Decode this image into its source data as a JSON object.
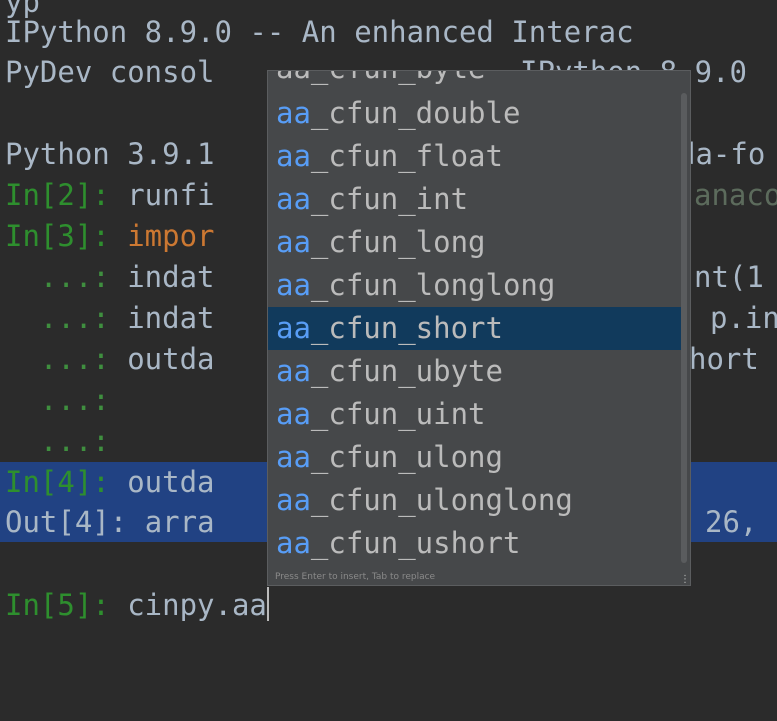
{
  "console": {
    "line0": "yp",
    "line1": "IPython 8.9.0 -- An enhanced Interac",
    "line2_prefix": "PyDev consol",
    "line2_suffix": "IPython 8.9.0",
    "line4_prefix": "Python 3.9.1",
    "line4_suffix": "da-fo",
    "in2_prompt": "In[2]: ",
    "in2_code": "runfi",
    "in2_tail": "anaco",
    "in3_prompt": "In[3]: ",
    "in3_code": "impor",
    "cont1_prompt": "  ...: ",
    "cont1_code": "indat",
    "cont1_tail": "nt(1",
    "cont2_prompt": "  ...: ",
    "cont2_code": "indat",
    "cont2_tail": "p.in",
    "cont3_prompt": "  ...: ",
    "cont3_code": "outda",
    "cont3_tail": "hort",
    "cont4_prompt": "  ...:",
    "cont5_prompt": "  ...:",
    "in4_prompt": "In[4]: ",
    "in4_code": "outda",
    "out4_prompt": "Out[4]: ",
    "out4_code": "arra",
    "out4_tail": "26,",
    "in5_prompt": "In[5]: ",
    "in5_code": "cinpy.aa"
  },
  "completion": {
    "partial_top": "aa_cfun_byte",
    "items": [
      {
        "prefix": "aa",
        "rest": "_cfun_double"
      },
      {
        "prefix": "aa",
        "rest": "_cfun_float"
      },
      {
        "prefix": "aa",
        "rest": "_cfun_int"
      },
      {
        "prefix": "aa",
        "rest": "_cfun_long"
      },
      {
        "prefix": "aa",
        "rest": "_cfun_longlong"
      },
      {
        "prefix": "aa",
        "rest": "_cfun_short"
      },
      {
        "prefix": "aa",
        "rest": "_cfun_ubyte"
      },
      {
        "prefix": "aa",
        "rest": "_cfun_uint"
      },
      {
        "prefix": "aa",
        "rest": "_cfun_ulong"
      },
      {
        "prefix": "aa",
        "rest": "_cfun_ulonglong"
      },
      {
        "prefix": "aa",
        "rest": "_cfun_ushort"
      }
    ],
    "selected_index": 5,
    "hint": "Press Enter to insert, Tab to replace",
    "more_icon": "⋮"
  }
}
